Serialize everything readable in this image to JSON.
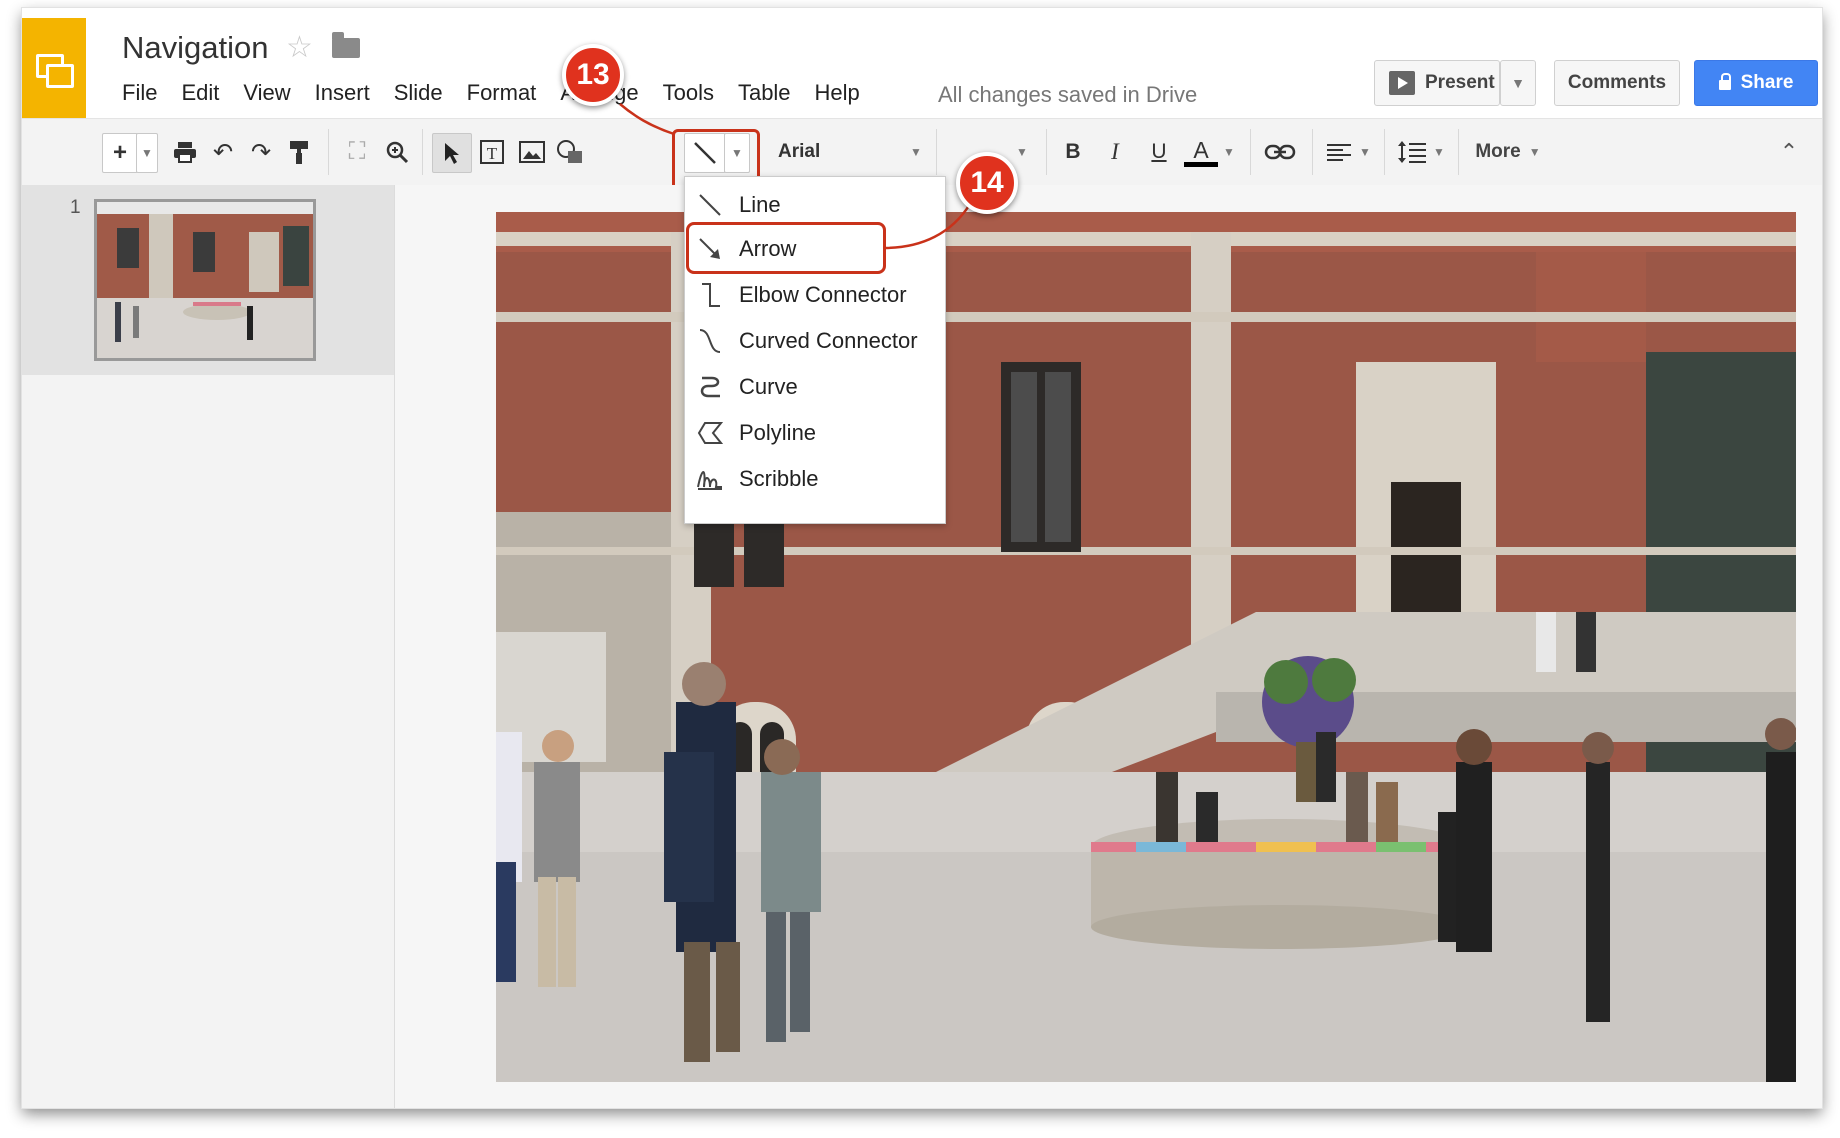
{
  "app": {
    "title": "Navigation",
    "menus": [
      "File",
      "Edit",
      "View",
      "Insert",
      "Slide",
      "Format",
      "Arrange",
      "Tools",
      "Table",
      "Help"
    ],
    "save_status": "All changes saved in Drive"
  },
  "header_buttons": {
    "present": "Present",
    "comments": "Comments",
    "share": "Share"
  },
  "toolbar": {
    "font": "Arial",
    "more": "More"
  },
  "line_menu": {
    "items": [
      "Line",
      "Arrow",
      "Elbow Connector",
      "Curved Connector",
      "Curve",
      "Polyline",
      "Scribble"
    ],
    "highlighted": "Arrow"
  },
  "filmstrip": {
    "slide_number": "1"
  },
  "callouts": {
    "step_a": "13",
    "step_b": "14"
  },
  "colors": {
    "accent": "#4285f4",
    "logo": "#f4b400",
    "callout": "#e0321e"
  }
}
